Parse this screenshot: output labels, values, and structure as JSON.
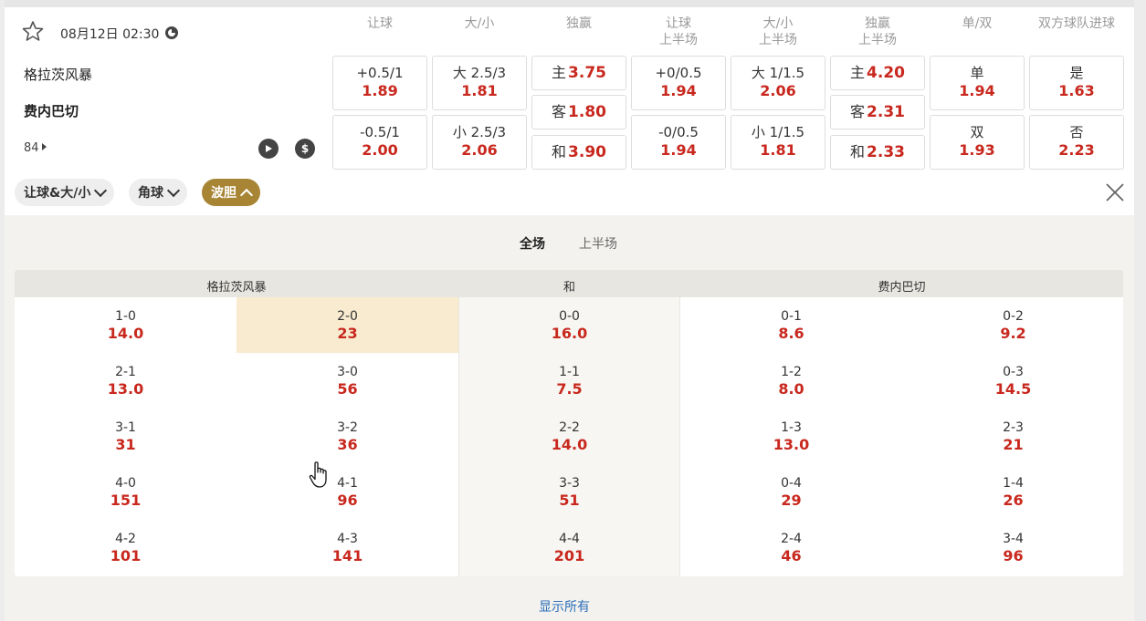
{
  "match": {
    "datetime": "08月12日 02:30",
    "home": "格拉茨风暴",
    "away": "费内巴切",
    "market_count": "84"
  },
  "columns": [
    {
      "line1": "让球",
      "line2": ""
    },
    {
      "line1": "大/小",
      "line2": ""
    },
    {
      "line1": "独赢",
      "line2": ""
    },
    {
      "line1": "让球",
      "line2": "上半场"
    },
    {
      "line1": "大/小",
      "line2": "上半场"
    },
    {
      "line1": "独赢",
      "line2": "上半场"
    },
    {
      "line1": "单/双",
      "line2": ""
    },
    {
      "line1": "双方球队进球",
      "line2": ""
    }
  ],
  "odds": {
    "handicap": [
      {
        "label": "+0.5/1",
        "value": "1.89"
      },
      {
        "label": "-0.5/1",
        "value": "2.00"
      }
    ],
    "over_under": [
      {
        "label": "大 2.5/3",
        "value": "1.81"
      },
      {
        "label": "小 2.5/3",
        "value": "2.06"
      }
    ],
    "moneyline": [
      {
        "label": "主",
        "value": "3.75"
      },
      {
        "label": "客",
        "value": "1.80"
      },
      {
        "label": "和",
        "value": "3.90"
      }
    ],
    "handicap_1h": [
      {
        "label": "+0/0.5",
        "value": "1.94"
      },
      {
        "label": "-0/0.5",
        "value": "1.94"
      }
    ],
    "over_under_1h": [
      {
        "label": "大 1/1.5",
        "value": "2.06"
      },
      {
        "label": "小 1/1.5",
        "value": "1.81"
      }
    ],
    "moneyline_1h": [
      {
        "label": "主",
        "value": "4.20"
      },
      {
        "label": "客",
        "value": "2.31"
      },
      {
        "label": "和",
        "value": "2.33"
      }
    ],
    "odd_even": [
      {
        "label": "单",
        "value": "1.94"
      },
      {
        "label": "双",
        "value": "1.93"
      }
    ],
    "both_score": [
      {
        "label": "是",
        "value": "1.63"
      },
      {
        "label": "否",
        "value": "2.23"
      }
    ]
  },
  "filters": {
    "chip1": "让球&大/小",
    "chip2": "角球",
    "chip3": "波胆"
  },
  "tabs": {
    "full": "全场",
    "half": "上半场"
  },
  "correct_score": {
    "headers": {
      "home": "格拉茨风暴",
      "draw": "和",
      "away": "费内巴切"
    },
    "columns": [
      [
        {
          "s": "1-0",
          "o": "14.0"
        },
        {
          "s": "2-1",
          "o": "13.0"
        },
        {
          "s": "3-1",
          "o": "31"
        },
        {
          "s": "4-0",
          "o": "151"
        },
        {
          "s": "4-2",
          "o": "101"
        }
      ],
      [
        {
          "s": "2-0",
          "o": "23"
        },
        {
          "s": "3-0",
          "o": "56"
        },
        {
          "s": "3-2",
          "o": "36"
        },
        {
          "s": "4-1",
          "o": "96"
        },
        {
          "s": "4-3",
          "o": "141"
        }
      ],
      [
        {
          "s": "0-0",
          "o": "16.0"
        },
        {
          "s": "1-1",
          "o": "7.5"
        },
        {
          "s": "2-2",
          "o": "14.0"
        },
        {
          "s": "3-3",
          "o": "51"
        },
        {
          "s": "4-4",
          "o": "201"
        }
      ],
      [
        {
          "s": "0-1",
          "o": "8.6"
        },
        {
          "s": "1-2",
          "o": "8.0"
        },
        {
          "s": "1-3",
          "o": "13.0"
        },
        {
          "s": "0-4",
          "o": "29"
        },
        {
          "s": "2-4",
          "o": "46"
        }
      ],
      [
        {
          "s": "0-2",
          "o": "9.2"
        },
        {
          "s": "0-3",
          "o": "14.5"
        },
        {
          "s": "2-3",
          "o": "21"
        },
        {
          "s": "1-4",
          "o": "26"
        },
        {
          "s": "3-4",
          "o": "96"
        }
      ]
    ]
  },
  "show_all": "显示所有",
  "colors": {
    "accent": "#a78534",
    "odds": "#c8281e",
    "highlight": "#f8ebcf",
    "link": "#2d6fb8"
  }
}
